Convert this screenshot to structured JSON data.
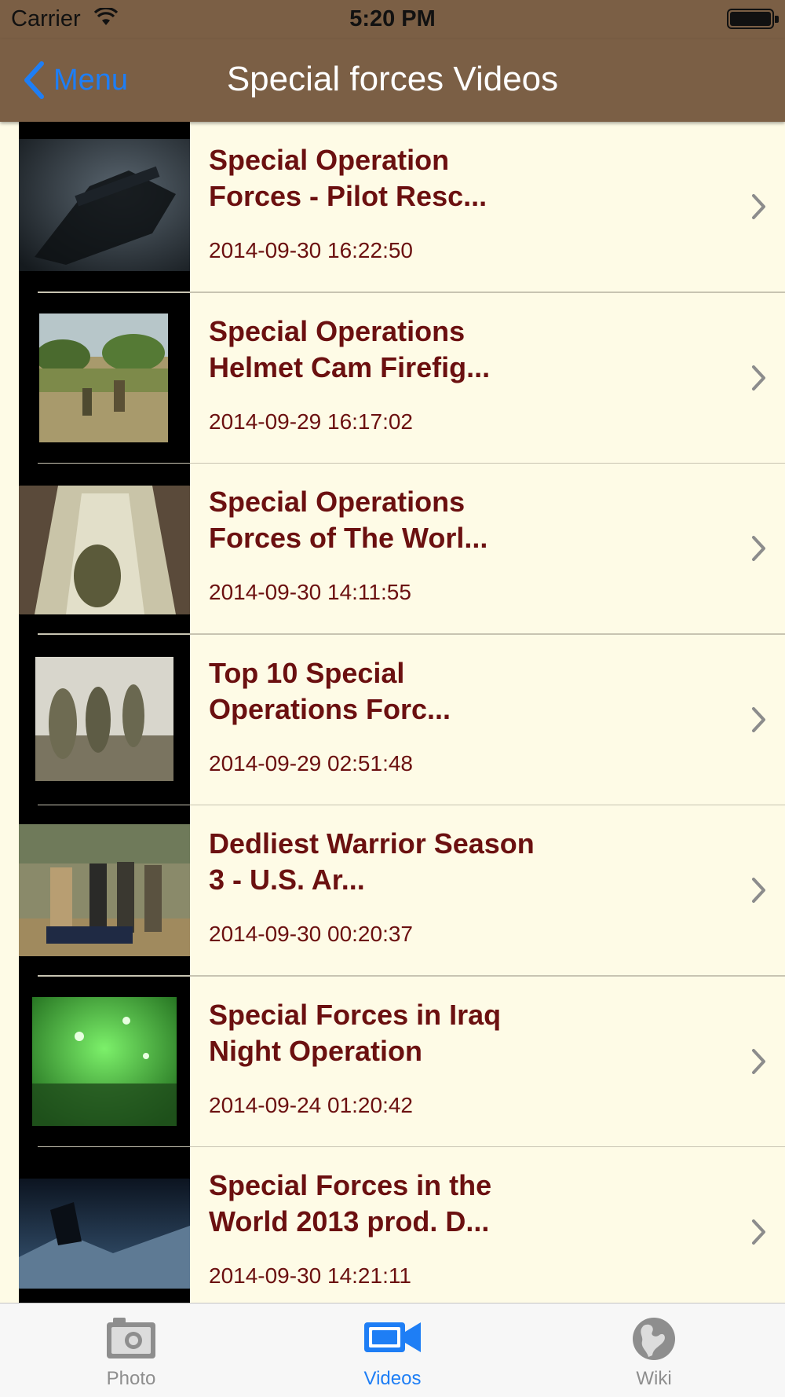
{
  "status_bar": {
    "carrier": "Carrier",
    "time": "5:20 PM"
  },
  "nav": {
    "back_label": "Menu",
    "title": "Special forces Videos"
  },
  "videos": [
    {
      "title": "Special Operation Forces - Pilot Resc...",
      "date": "2014-09-30 16:22:50"
    },
    {
      "title": "Special Operations Helmet Cam Firefig...",
      "date": "2014-09-29 16:17:02"
    },
    {
      "title": "Special Operations Forces of The Worl...",
      "date": "2014-09-30 14:11:55"
    },
    {
      "title": "Top 10 Special Operations Forc...",
      "date": "2014-09-29 02:51:48"
    },
    {
      "title": "Dedliest Warrior Season 3 - U.S. Ar...",
      "date": "2014-09-30 00:20:37"
    },
    {
      "title": "Special Forces in Iraq Night Operation",
      "date": "2014-09-24 01:20:42"
    },
    {
      "title": "Special Forces in the World 2013 prod. D...",
      "date": "2014-09-30 14:21:11"
    }
  ],
  "tabs": [
    {
      "label": "Photo",
      "icon": "camera-icon",
      "selected": false
    },
    {
      "label": "Videos",
      "icon": "video-camera-icon",
      "selected": true
    },
    {
      "label": "Wiki",
      "icon": "globe-icon",
      "selected": false
    }
  ],
  "colors": {
    "nav_background": "#7b5f45",
    "list_background": "#fefbe6",
    "title_text": "#6b1010",
    "tint": "#1e7ef5",
    "tab_inactive": "#8e8e8e"
  }
}
